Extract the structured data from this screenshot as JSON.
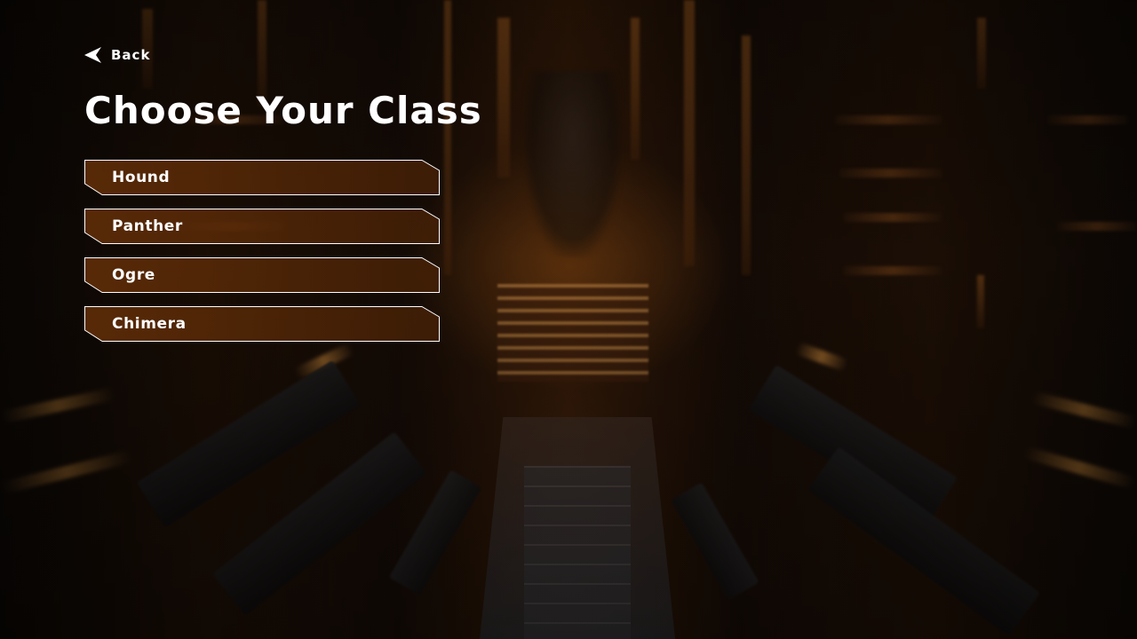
{
  "navigation": {
    "back_label": "Back",
    "back_icon": "chevron-left-icon"
  },
  "screen": {
    "title": "Choose Your Class"
  },
  "classes": [
    {
      "label": "Hound"
    },
    {
      "label": "Panther"
    },
    {
      "label": "Ogre"
    },
    {
      "label": "Chimera"
    }
  ],
  "colors": {
    "text": "#ffffff",
    "option_fill": "#5a2a08",
    "option_border": "#ffffff",
    "background_accent": "#c8742a"
  }
}
